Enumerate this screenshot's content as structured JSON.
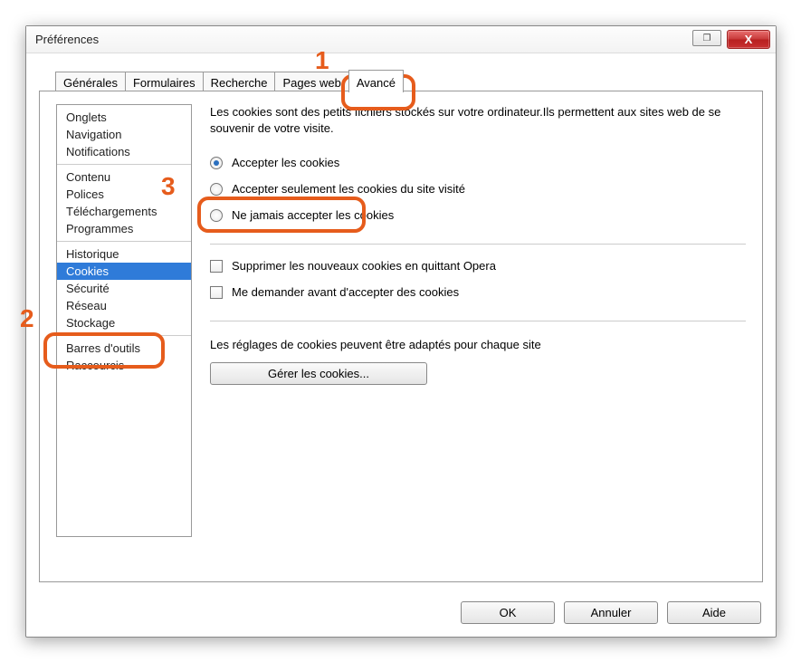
{
  "window": {
    "title": "Préférences"
  },
  "titlebar_buttons": {
    "minmax": "❐",
    "close": "X"
  },
  "tabs": [
    {
      "label": "Générales",
      "active": false
    },
    {
      "label": "Formulaires",
      "active": false
    },
    {
      "label": "Recherche",
      "active": false
    },
    {
      "label": "Pages web",
      "active": false
    },
    {
      "label": "Avancé",
      "active": true
    }
  ],
  "sidebar": {
    "groups": [
      [
        "Onglets",
        "Navigation",
        "Notifications"
      ],
      [
        "Contenu",
        "Polices",
        "Téléchargements",
        "Programmes"
      ],
      [
        "Historique",
        "Cookies",
        "Sécurité",
        "Réseau",
        "Stockage"
      ],
      [
        "Barres d'outils",
        "Raccourcis"
      ]
    ],
    "selected": "Cookies"
  },
  "main": {
    "intro": "Les cookies sont des petits fichiers stockés sur votre ordinateur.Ils permettent aux sites web de se souvenir de votre visite.",
    "radio_options": [
      {
        "label": "Accepter les cookies",
        "checked": true
      },
      {
        "label": "Accepter seulement les cookies du site visité",
        "checked": false
      },
      {
        "label": "Ne jamais accepter les cookies",
        "checked": false
      }
    ],
    "check_options": [
      {
        "label": "Supprimer les nouveaux cookies en quittant Opera",
        "checked": false
      },
      {
        "label": "Me demander avant d'accepter des cookies",
        "checked": false
      }
    ],
    "settings_note": "Les réglages de cookies peuvent être adaptés pour chaque site",
    "manage_button": "Gérer les cookies..."
  },
  "footer": {
    "ok": "OK",
    "cancel": "Annuler",
    "help": "Aide"
  },
  "annotations": {
    "n1": "1",
    "n2": "2",
    "n3": "3"
  }
}
